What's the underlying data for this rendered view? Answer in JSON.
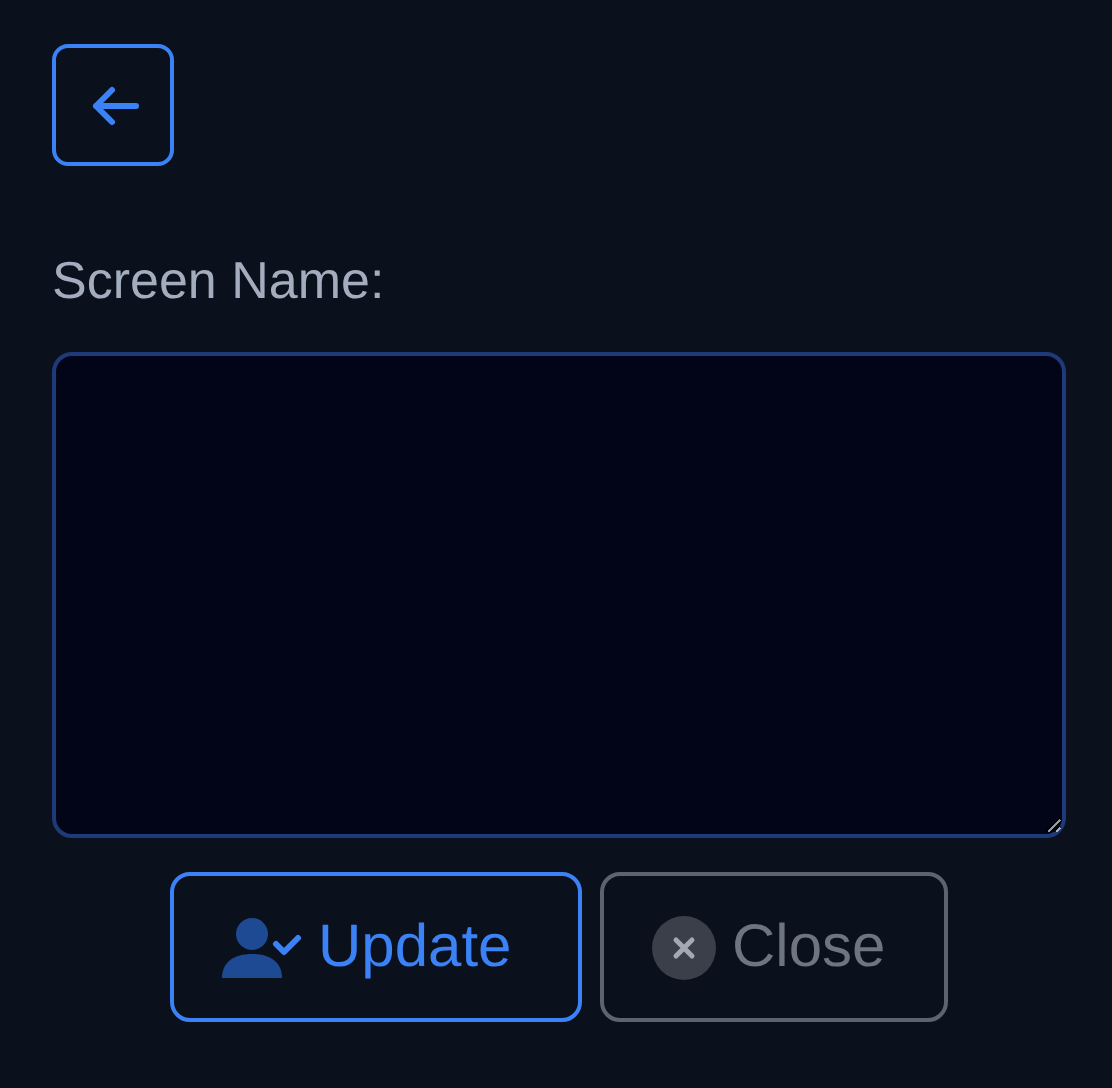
{
  "back_button": {
    "kind": "back"
  },
  "field": {
    "label": "Screen Name:"
  },
  "buttons": [
    {
      "label": "Update",
      "kind": "primary"
    },
    {
      "label": "Close",
      "kind": "secondary"
    }
  ]
}
